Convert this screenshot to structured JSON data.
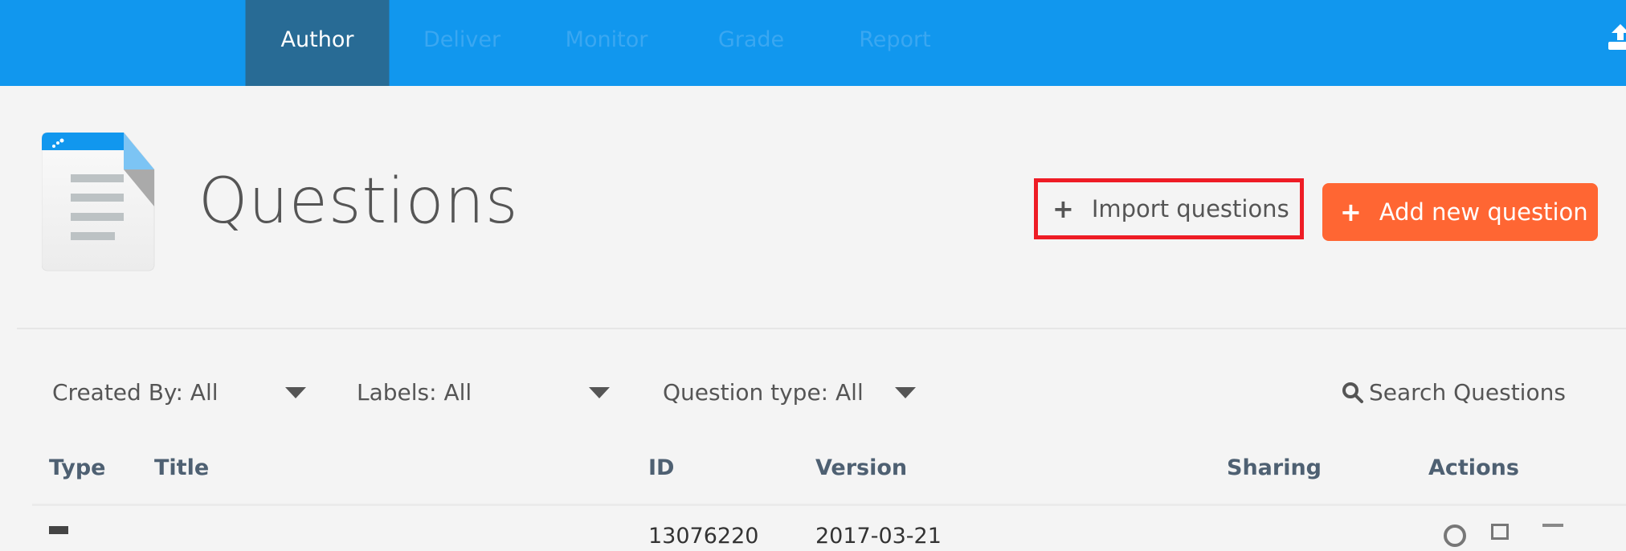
{
  "nav": {
    "tabs": [
      {
        "label": "Author",
        "active": true
      },
      {
        "label": "Deliver",
        "active": false
      },
      {
        "label": "Monitor",
        "active": false
      },
      {
        "label": "Grade",
        "active": false
      },
      {
        "label": "Report",
        "active": false
      }
    ],
    "upload_icon": "upload-icon"
  },
  "header": {
    "title": "Questions",
    "icon": "document-icon",
    "import_label": "Import questions",
    "add_label": "Add new question"
  },
  "filters": {
    "created_by": "Created By: All",
    "labels": "Labels: All",
    "question_type": "Question type: All",
    "search": "Search Questions"
  },
  "table": {
    "columns": [
      "Type",
      "Title",
      "ID",
      "Version",
      "Sharing",
      "Actions"
    ],
    "rows": [
      {
        "id": "13076220",
        "version": "2017-03-21"
      }
    ]
  },
  "colors": {
    "nav": "#1197ee",
    "active_tab": "#286b95",
    "add_button": "#ff6633",
    "highlight": "#ee1c25"
  }
}
